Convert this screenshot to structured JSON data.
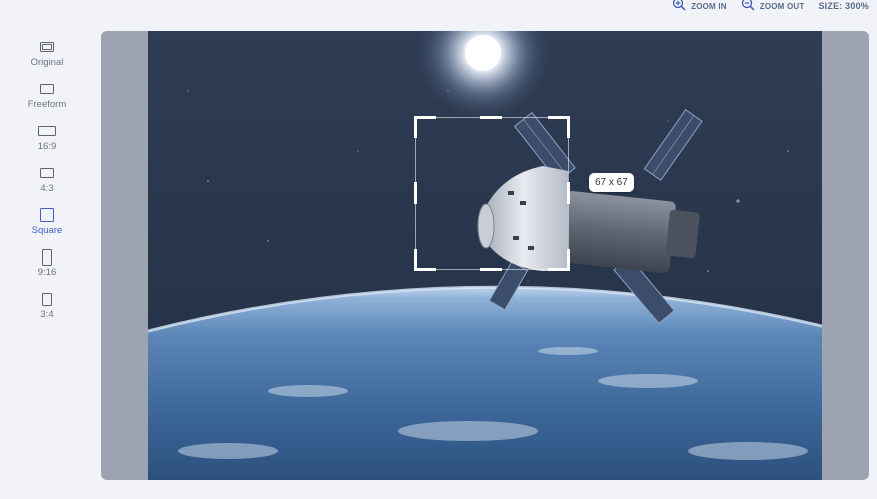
{
  "toolbar": {
    "zoom_in_label": "ZOOM IN",
    "zoom_out_label": "ZOOM OUT",
    "size_text": "SIZE: 300%"
  },
  "sidebar": {
    "items": [
      {
        "label": "Original",
        "icon": "original-ratio-icon"
      },
      {
        "label": "Freeform",
        "icon": "freeform-ratio-icon"
      },
      {
        "label": "16:9",
        "icon": "ratio-16-9-icon"
      },
      {
        "label": "4:3",
        "icon": "ratio-4-3-icon"
      },
      {
        "label": "Square",
        "icon": "square-ratio-icon",
        "active": true
      },
      {
        "label": "9:16",
        "icon": "ratio-9-16-icon"
      },
      {
        "label": "3:4",
        "icon": "ratio-3-4-icon"
      }
    ]
  },
  "crop": {
    "dimensions": "67 x 67"
  },
  "colors": {
    "accent": "#3f5fc7",
    "canvas_bg": "#9da3b1",
    "page_bg": "#f1f3f8"
  }
}
